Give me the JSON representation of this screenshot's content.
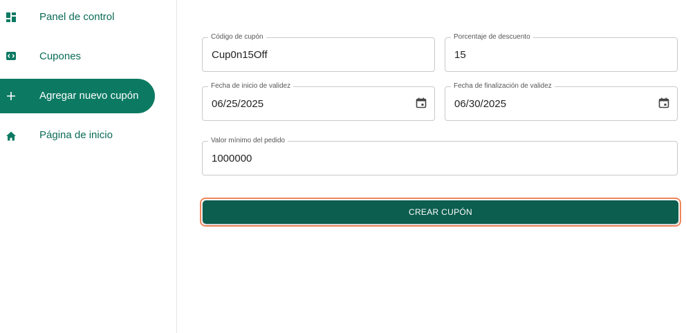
{
  "sidebar": {
    "items": [
      {
        "label": "Panel de control",
        "icon": "dashboard-icon"
      },
      {
        "label": "Cupones",
        "icon": "code-icon"
      },
      {
        "label": "Agregar nuevo cupón",
        "icon": "plus-icon",
        "active": true
      },
      {
        "label": "Página de inicio",
        "icon": "home-icon"
      }
    ]
  },
  "form": {
    "coupon_code": {
      "label": "Código de cupón",
      "value": "Cup0n15Off"
    },
    "discount_percent": {
      "label": "Porcentaje de descuento",
      "value": "15"
    },
    "start_date": {
      "label": "Fecha de inicio de validez",
      "value": "06/25/2025"
    },
    "end_date": {
      "label": "Fecha de finalización de validez",
      "value": "06/30/2025"
    },
    "min_order": {
      "label": "Valor mínimo del pedido",
      "value": "1000000"
    },
    "submit_label": "CREAR CUPÓN"
  },
  "colors": {
    "accent": "#0c7a63",
    "button": "#0c5e4f",
    "focus_ring": "#f0855a"
  }
}
